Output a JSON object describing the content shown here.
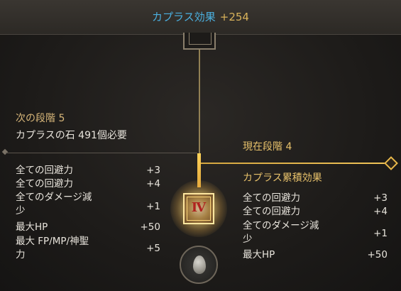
{
  "header": {
    "label": "カプラス効果",
    "value": "+254"
  },
  "next": {
    "stage_label": "次の段階 5",
    "cost_label": "カプラスの石 491個必要"
  },
  "current": {
    "stage_label": "現在段階 4",
    "cumulative_title": "カプラス累積効果"
  },
  "next_stats": [
    {
      "name": "全ての回避力",
      "value": "+3"
    },
    {
      "name": "全ての回避力",
      "value": "+4"
    },
    {
      "name_line1": "全てのダメージ減",
      "name_line2": "少",
      "value": "+1"
    },
    {
      "name": "最大HP",
      "value": "+50"
    },
    {
      "name_line1": "最大 FP/MP/神聖",
      "name_line2": "力",
      "value": "+5"
    }
  ],
  "current_stats": [
    {
      "name": "全ての回避力",
      "value": "+3"
    },
    {
      "name": "全ての回避力",
      "value": "+4"
    },
    {
      "name_line1": "全てのダメージ減",
      "name_line2": "少",
      "value": "+1"
    },
    {
      "name": "最大HP",
      "value": "+50"
    }
  ],
  "badge": {
    "roman": "Ⅳ"
  },
  "icons": {
    "node_top": "stage-node-icon",
    "orb": "kaplas-stone-icon",
    "badge": "stage-4-badge-icon"
  }
}
